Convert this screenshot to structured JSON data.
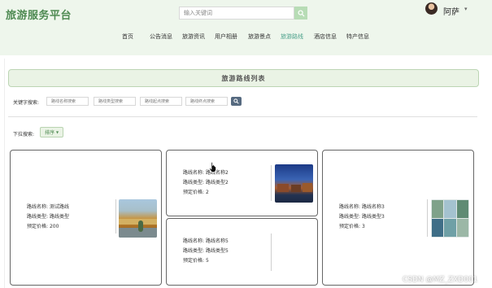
{
  "header": {
    "brand": "旅游服务平台",
    "search": {
      "placeholder": "输入关键词"
    },
    "user": {
      "name": "阿萨"
    }
  },
  "nav": {
    "items": [
      {
        "label": "首页",
        "active": false
      },
      {
        "label": "公告消息",
        "active": false
      },
      {
        "label": "旅游资讯",
        "active": false
      },
      {
        "label": "用户相册",
        "active": false
      },
      {
        "label": "旅游景点",
        "active": false
      },
      {
        "label": "旅游路线",
        "active": true
      },
      {
        "label": "酒店信息",
        "active": false
      },
      {
        "label": "特产信息",
        "active": false
      }
    ],
    "active_color": "#4aa08a"
  },
  "page": {
    "title": "旅游路线列表",
    "keyword_label": "关键字搜索:",
    "filters": [
      {
        "placeholder": "路线名称搜索"
      },
      {
        "placeholder": "路线类型搜索"
      },
      {
        "placeholder": "路线起点搜索"
      },
      {
        "placeholder": "路线终点搜索"
      }
    ],
    "dropdown_label": "下拉搜索:",
    "sort_button": "排序"
  },
  "labels": {
    "name": "路线名称: ",
    "type": "路线类型: ",
    "price": "预定价格: "
  },
  "routes": [
    {
      "name": "测试路线",
      "type": "路线类型",
      "price": "200",
      "image": "autumn-river-photo"
    },
    {
      "name": "路线名称2",
      "type": "路线类型2",
      "price": "2",
      "image": "water-town-night-photo"
    },
    {
      "name": "路线名称3",
      "type": "路线类型3",
      "price": "3",
      "image": "scenery-collage-photo"
    },
    {
      "name": "路线名称5",
      "type": "路线类型5",
      "price": "5",
      "image": ""
    }
  ],
  "watermark": "CSDN @MZ_ZXD001",
  "colors": {
    "brand": "#4e8a52",
    "header_bg": "#eef6ec",
    "title_bar_bg": "#eaf3e5",
    "search_btn": "#b7dcb5"
  }
}
